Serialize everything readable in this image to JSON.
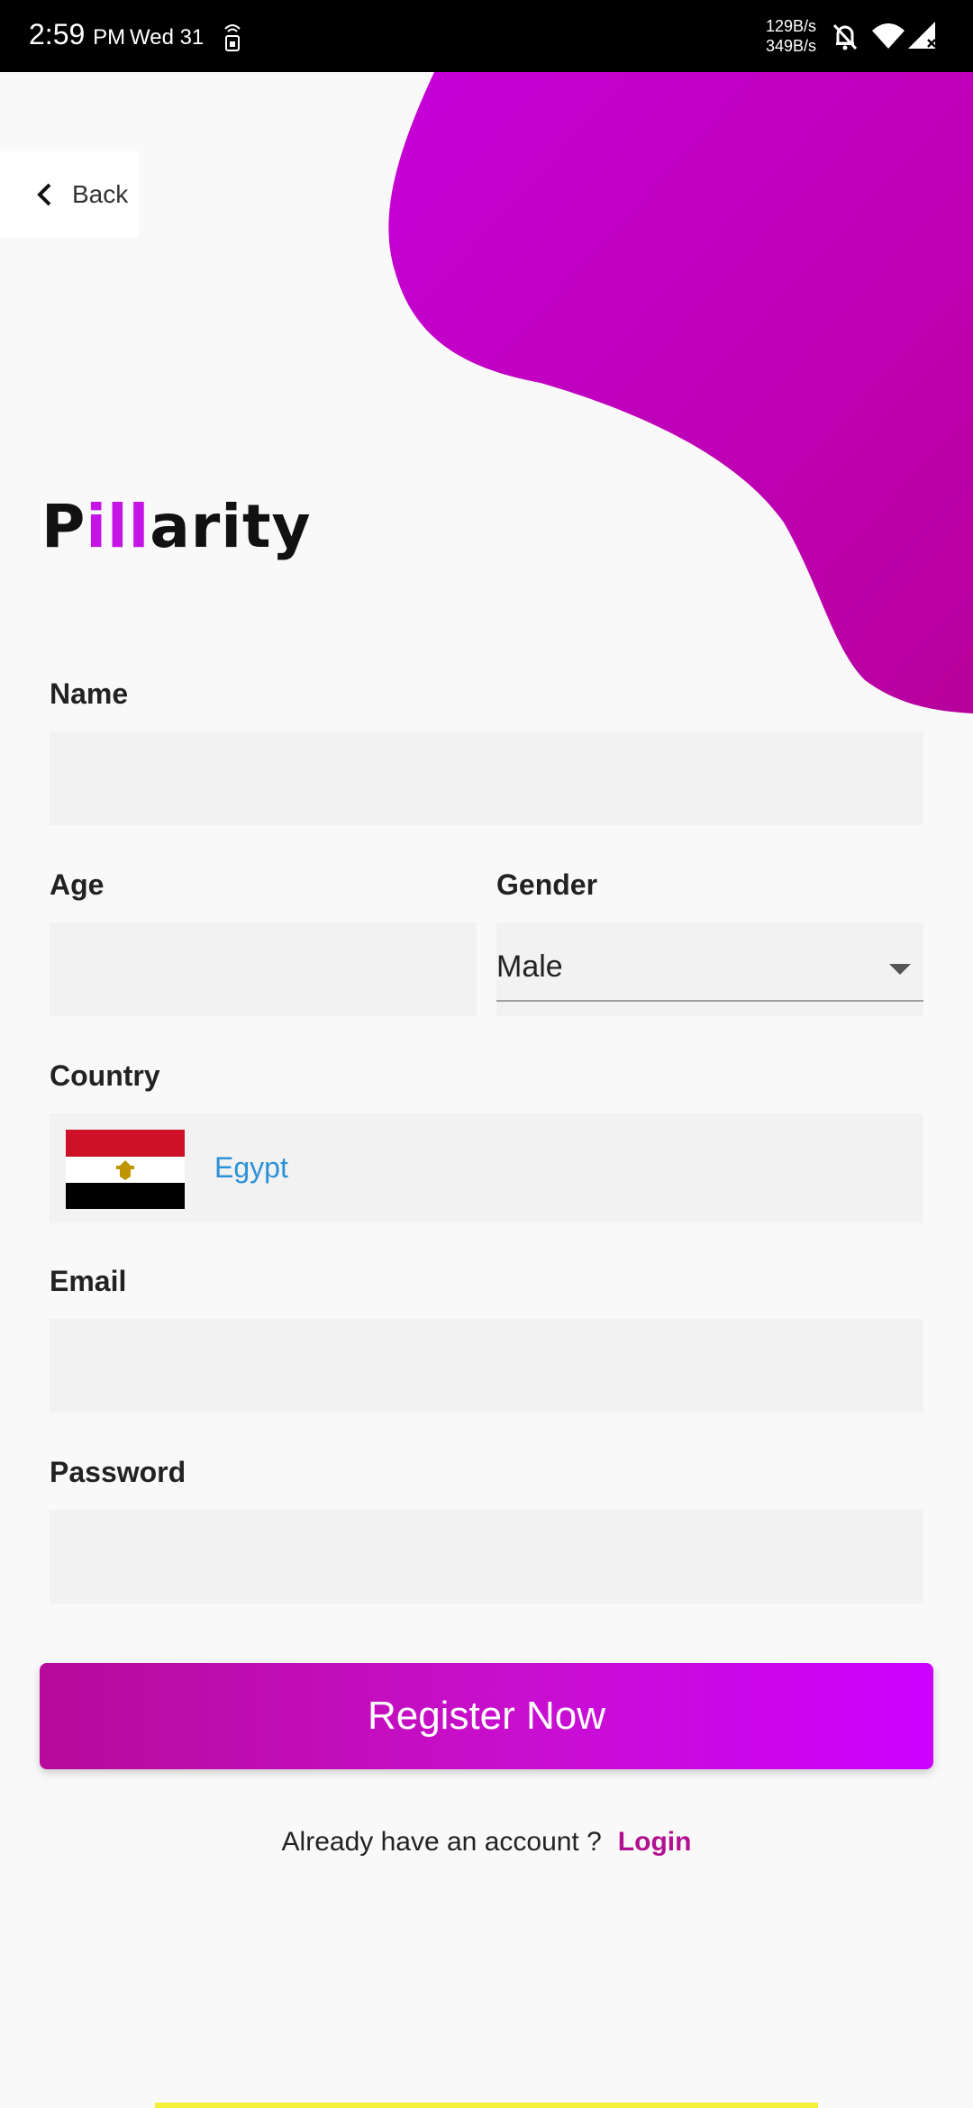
{
  "status_bar": {
    "time": "2:59",
    "ampm": "PM",
    "day": "Wed 31",
    "speed_up": "129B/s",
    "speed_down": "349B/s",
    "icons": [
      "sim-icon",
      "mute-bell-icon",
      "wifi-icon",
      "signal-icon"
    ]
  },
  "nav": {
    "back_label": "Back"
  },
  "brand": {
    "logo_part1": "P",
    "logo_part2": "ill",
    "logo_part3": "arity"
  },
  "form": {
    "name_label": "Name",
    "name_value": "",
    "age_label": "Age",
    "age_value": "",
    "gender_label": "Gender",
    "gender_value": "Male",
    "country_label": "Country",
    "country_value": "Egypt",
    "email_label": "Email",
    "email_value": "",
    "password_label": "Password",
    "password_value": ""
  },
  "actions": {
    "register_label": "Register Now",
    "already_text": "Already have an account ?",
    "login_label": "Login"
  },
  "colors": {
    "accent": "#c514e6",
    "button_start": "#b80a9a",
    "button_end": "#cc00ff",
    "country_text": "#2b92d8",
    "login_link": "#b1108f"
  }
}
